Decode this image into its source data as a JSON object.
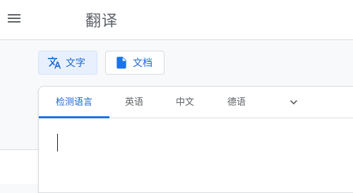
{
  "header": {
    "title": "翻译"
  },
  "modes": [
    {
      "label": "文字",
      "icon": "translate-icon",
      "active": true
    },
    {
      "label": "文档",
      "icon": "document-icon",
      "active": false
    }
  ],
  "source_tabs": [
    {
      "label": "检测语言",
      "active": true
    },
    {
      "label": "英语",
      "active": false
    },
    {
      "label": "中文",
      "active": false
    },
    {
      "label": "德语",
      "active": false
    }
  ],
  "more_languages_icon": "chevron-down-icon",
  "colors": {
    "accent": "#1a73e8",
    "accent_text": "#1967d2",
    "active_bg": "#e8f0fe"
  }
}
